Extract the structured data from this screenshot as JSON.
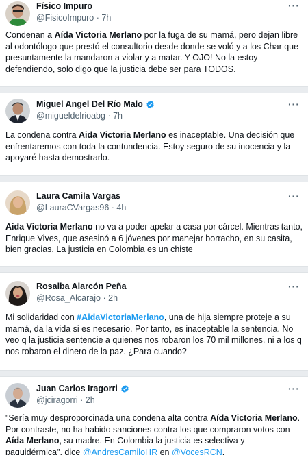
{
  "tweets": [
    {
      "name": "Físico Impuro",
      "handle": "@FisicoImpuro",
      "dot": "·",
      "time": "7h",
      "verified": false,
      "more": "···",
      "body": [
        {
          "t": "Condenan a "
        },
        {
          "t": "Aída Victoria Merlano",
          "b": true
        },
        {
          "t": " por la fuga de su mamá, pero dejan libre al odontólogo que prestó el consultorio desde donde se voló y a los Char que presuntamente la mandaron a violar y a matar. Y OJO! No la estoy defendiendo, solo digo que la justicia debe ser para TODOS."
        }
      ]
    },
    {
      "name": "Miguel Angel Del Río Malo",
      "handle": "@migueldelrioabg",
      "dot": "·",
      "time": "7h",
      "verified": true,
      "more": "···",
      "body": [
        {
          "t": "La condena contra "
        },
        {
          "t": "Aida Victoria Merlano",
          "b": true
        },
        {
          "t": " es inaceptable. Una decisión  que enfrentaremos con toda la contundencia. Estoy seguro de su inocencia y la apoyaré hasta demostrarlo."
        }
      ]
    },
    {
      "name": "Laura Camila Vargas",
      "handle": "@LauraCVargas96",
      "dot": "·",
      "time": "4h",
      "verified": false,
      "more": "···",
      "body": [
        {
          "t": "Aida Victoria Merlano",
          "b": true
        },
        {
          "t": " no va a poder apelar a casa por cárcel. Mientras tanto, Enrique Vives, que asesinó a 6 jóvenes por manejar borracho, en su casita, bien gracias. La justicia en Colombia es un chiste"
        }
      ]
    },
    {
      "name": "Rosalba Alarcón Peña",
      "handle": "@Rosa_Alcarajo",
      "dot": "·",
      "time": "2h",
      "verified": false,
      "more": "···",
      "body": [
        {
          "t": "Mi solidaridad con "
        },
        {
          "t": "#AidaVictoriaMerlano",
          "link": true,
          "b": true
        },
        {
          "t": ", una de hija siempre proteje a su mamá, da la vida si es necesario. Por tanto, es inaceptable la sentencia. No veo q la justicia sentencie a quienes nos robaron los 70 mil millones, ni a los q nos robaron el dinero de la paz. ¿Para cuando?"
        }
      ]
    },
    {
      "name": "Juan Carlos Iragorri",
      "handle": "@jciragorri",
      "dot": "·",
      "time": "2h",
      "verified": true,
      "more": "···",
      "body": [
        {
          "t": "\"Sería muy desproporcinada una condena alta contra "
        },
        {
          "t": "Aída Victoria Merlano",
          "b": true
        },
        {
          "t": ". Por contraste, no ha habido sanciones contra los que compraron votos con "
        },
        {
          "t": "Aída Merlano",
          "b": true
        },
        {
          "t": ", su madre. En Colombia la justicia es selectiva y paquidérmica\", dice "
        },
        {
          "t": "@AndresCamiloHR",
          "link": true
        },
        {
          "t": " en "
        },
        {
          "t": "@VocesRCN",
          "link": true
        },
        {
          "t": "."
        }
      ]
    }
  ],
  "colors": {
    "link": "#1d9bf0",
    "verified": "#1d9bf0",
    "muted": "#536471",
    "separator": "#e9ecef"
  }
}
